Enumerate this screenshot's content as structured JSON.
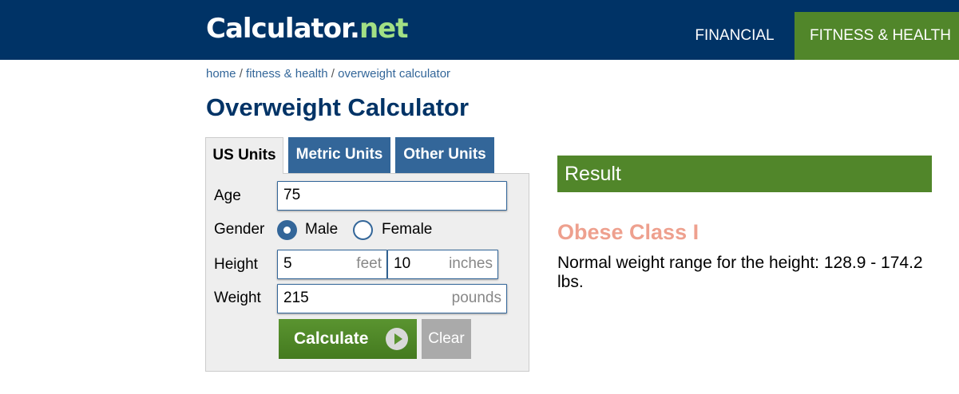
{
  "header": {
    "logo_part1": "Calculator",
    "logo_part2": ".",
    "logo_part3": "net",
    "nav": {
      "financial": "FINANCIAL",
      "fitness": "FITNESS & HEALTH"
    },
    "colors": {
      "bar": "#003366",
      "active_tab": "#51862a",
      "logo_accent": "#a2e085"
    }
  },
  "breadcrumb": {
    "home": "home",
    "sep": " / ",
    "fitness": "fitness & health",
    "current": "overweight calculator"
  },
  "page_title": "Overweight Calculator",
  "tabs": {
    "us": "US Units",
    "metric": "Metric Units",
    "other": "Other Units",
    "active": "US Units"
  },
  "form": {
    "age_label": "Age",
    "age_value": "75",
    "gender_label": "Gender",
    "gender_male": "Male",
    "gender_female": "Female",
    "gender_selected": "Male",
    "height_label": "Height",
    "height_feet_value": "5",
    "height_feet_unit": "feet",
    "height_inches_value": "10",
    "height_inches_unit": "inches",
    "weight_label": "Weight",
    "weight_value": "215",
    "weight_unit": "pounds",
    "calculate_label": "Calculate",
    "clear_label": "Clear"
  },
  "result": {
    "heading": "Result",
    "classification": "Obese Class I",
    "description": "Normal weight range for the height: 128.9 - 174.2 lbs.",
    "colors": {
      "heading_bg": "#51862a",
      "classification": "#eea08e"
    }
  }
}
